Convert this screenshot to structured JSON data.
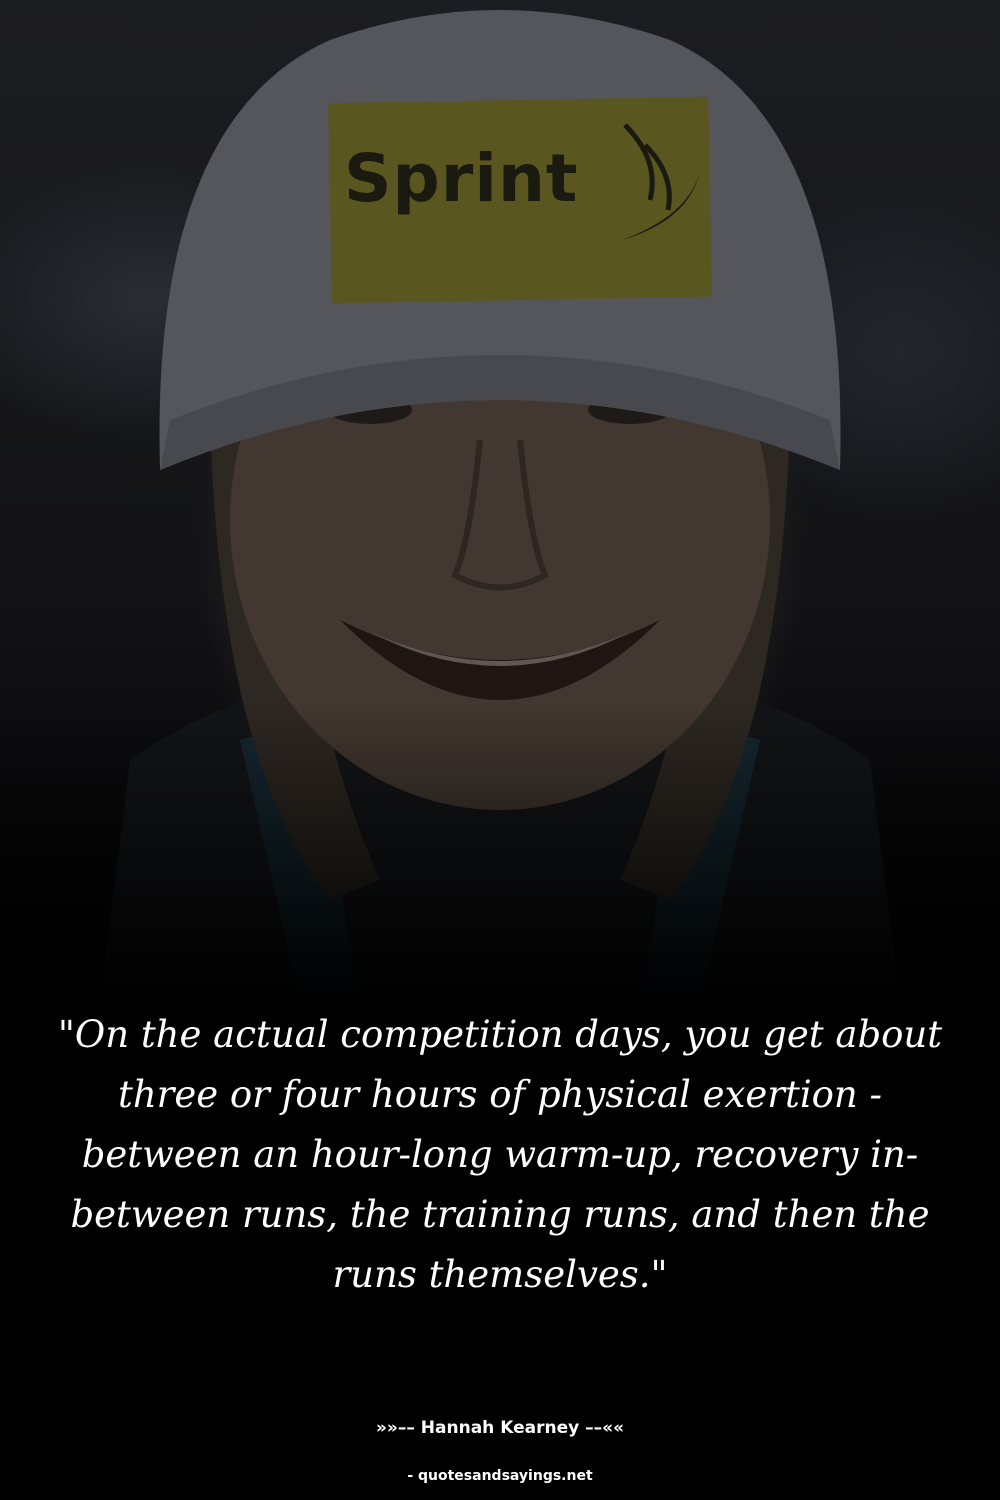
{
  "photo": {
    "logo_text": "Sprint",
    "colors": {
      "patch": "#c2bd34",
      "hat": "#5a5a5e",
      "skin": "#4a3d35",
      "background": "#000000"
    }
  },
  "quote": {
    "text": "\"On the actual competition days, you get about three or four hours of physical exertion - between an hour-long warm-up, recovery in-between runs, the training runs, and then the runs themselves.\""
  },
  "author": {
    "text": "»»–– Hannah Kearney ––««"
  },
  "source": {
    "text": "- quotesandsayings.net"
  }
}
